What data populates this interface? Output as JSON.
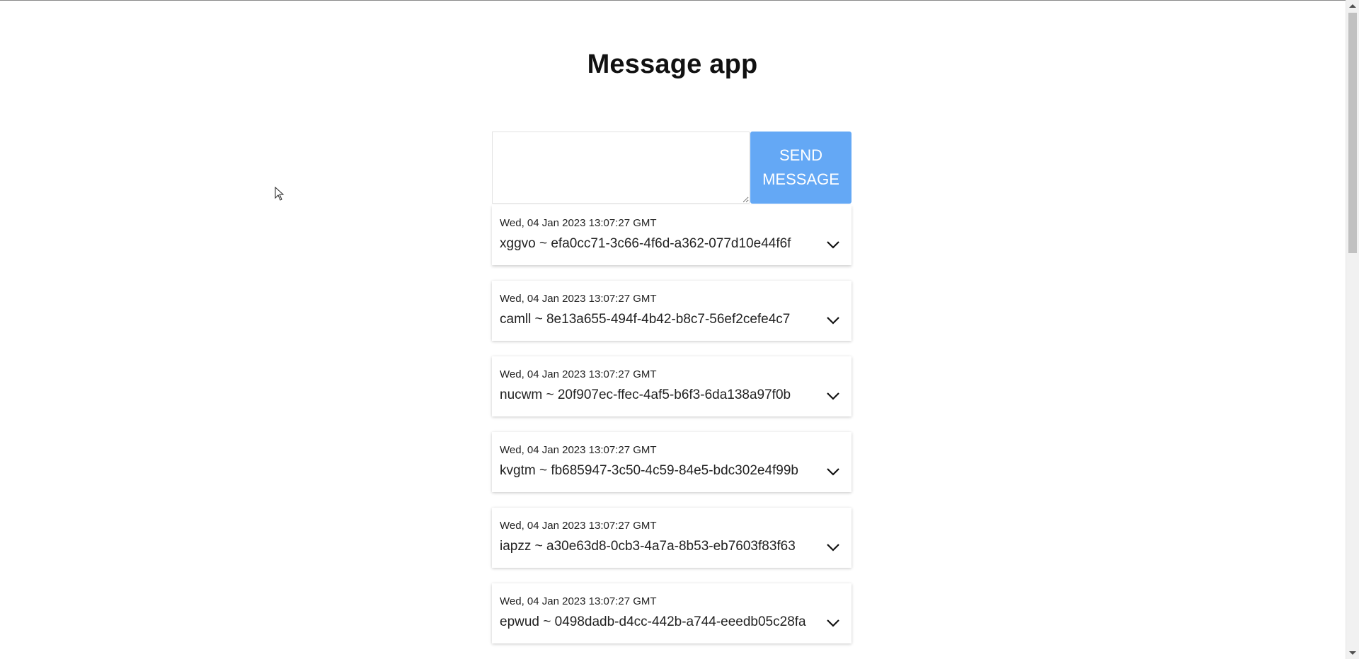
{
  "app": {
    "title": "Message app"
  },
  "composer": {
    "textarea_value": "",
    "send_label": "SEND MESSAGE"
  },
  "messages": [
    {
      "time": "Wed, 04 Jan 2023 13:07:27 GMT",
      "content": "xggvo ~ efa0cc71-3c66-4f6d-a362-077d10e44f6f"
    },
    {
      "time": "Wed, 04 Jan 2023 13:07:27 GMT",
      "content": "camll ~ 8e13a655-494f-4b42-b8c7-56ef2cefe4c7"
    },
    {
      "time": "Wed, 04 Jan 2023 13:07:27 GMT",
      "content": "nucwm ~ 20f907ec-ffec-4af5-b6f3-6da138a97f0b"
    },
    {
      "time": "Wed, 04 Jan 2023 13:07:27 GMT",
      "content": "kvgtm ~ fb685947-3c50-4c59-84e5-bdc302e4f99b"
    },
    {
      "time": "Wed, 04 Jan 2023 13:07:27 GMT",
      "content": "iapzz ~ a30e63d8-0cb3-4a7a-8b53-eb7603f83f63"
    },
    {
      "time": "Wed, 04 Jan 2023 13:07:27 GMT",
      "content": "epwud ~ 0498dadb-d4cc-442b-a744-eeedb05c28fa"
    }
  ],
  "colors": {
    "send_button": "#64a8f5",
    "background": "#ffffff"
  },
  "icons": {
    "message_expand": "chevron-down-icon",
    "mouse_cursor": "mouse-cursor-icon"
  }
}
